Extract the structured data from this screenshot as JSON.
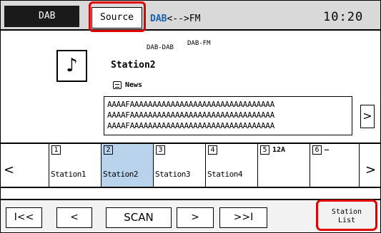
{
  "topbar": {
    "mode_tab": "DAB",
    "source_label": "Source",
    "dab_link": "DAB",
    "dab_link_rest": "<-->FM",
    "clock": "10:20"
  },
  "main": {
    "note_glyph": "♪",
    "dab_dab_label": "DAB-DAB",
    "dab_fm_label": "DAB-FM",
    "station_name": "Station2",
    "pty_label": "News",
    "dls_lines": [
      "AAAAFAAAAAAAAAAAAAAAAAAAAAAAAAAAAAAAA",
      "AAAAFAAAAAAAAAAAAAAAAAAAAAAAAAAAAAAAA",
      "AAAAFAAAAAAAAAAAAAAAAAAAAAAAAAAAAAAAA"
    ],
    "more_glyph": ">"
  },
  "presets": {
    "prev_glyph": "<",
    "next_glyph": ">",
    "items": [
      {
        "num": "1",
        "value": "",
        "name": "Station1",
        "selected": false
      },
      {
        "num": "2",
        "value": "",
        "name": "Station2",
        "selected": true
      },
      {
        "num": "3",
        "value": "",
        "name": "Station3",
        "selected": false
      },
      {
        "num": "4",
        "value": "",
        "name": "Station4",
        "selected": false
      },
      {
        "num": "5",
        "value": "12A",
        "name": "",
        "selected": false
      },
      {
        "num": "6",
        "value": "—",
        "name": "",
        "selected": false
      }
    ]
  },
  "controls": {
    "skip_back": "I<<",
    "prev": "<",
    "scan": "SCAN",
    "next": ">",
    "skip_fwd": ">>I",
    "station_list_line1": "Station",
    "station_list_line2": "List"
  },
  "colors": {
    "highlight": "#e00000",
    "accent": "#1a5fb4",
    "selected_preset": "#b9d3ec"
  }
}
